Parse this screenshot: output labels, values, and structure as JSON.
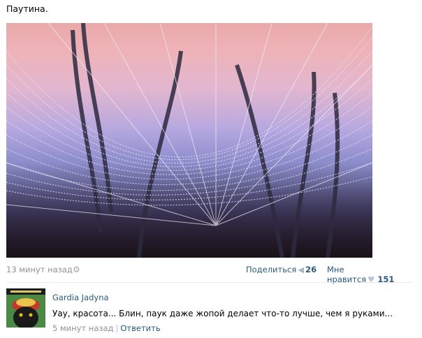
{
  "post": {
    "text": "Паутина.",
    "image_description_icon": "spider-web-photo"
  },
  "meta": {
    "timestamp": "13 минут назад",
    "settings_icon": "gear-icon",
    "share_label": "Поделиться",
    "share_icon": "megaphone-icon",
    "share_count": "26",
    "like_label": "Мне нравится",
    "like_icon": "heart-icon",
    "like_count": "151"
  },
  "comment": {
    "author": "Gardia Jadyna",
    "text": "Уау, красота... Блин, паук даже жопой делает что-то лучше, чем я руками...",
    "timestamp": "5 минут назад",
    "separator": "|",
    "reply_label": "Ответить"
  },
  "colors": {
    "link": "#2b587a",
    "muted": "#909090"
  }
}
